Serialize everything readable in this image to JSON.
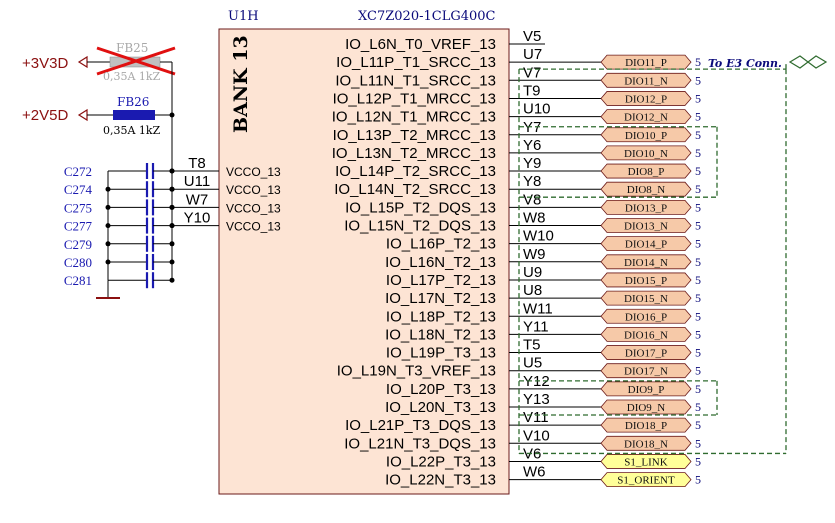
{
  "component": {
    "ref": "U1H",
    "part": "XC7Z020-1CLG400C",
    "bank": "BANK 13",
    "color_fill": "#fde4d4",
    "color_border": "#6b1a1a"
  },
  "power": {
    "p3v3": "+3V3D",
    "p2v5": "+2V5D",
    "fb25": {
      "ref": "FB25",
      "value": "0,35A 1kZ"
    },
    "fb26": {
      "ref": "FB26",
      "value": "0,35A 1kZ"
    },
    "color_power": "#8b1010",
    "color_cross": "#e01010"
  },
  "caps": [
    "C272",
    "C274",
    "C275",
    "C277",
    "C279",
    "C280",
    "C281"
  ],
  "vcco": [
    {
      "pin": "T8",
      "label": "VCCO_13"
    },
    {
      "pin": "U11",
      "label": "VCCO_13"
    },
    {
      "pin": "W7",
      "label": "VCCO_13"
    },
    {
      "pin": "Y10",
      "label": "VCCO_13"
    }
  ],
  "pins": [
    {
      "label": "IO_L6N_T0_VREF_13",
      "num": "V5",
      "net": "",
      "sheet": ""
    },
    {
      "label": "IO_L11P_T1_SRCC_13",
      "num": "U7",
      "net": "DIO11_P",
      "sheet": "5"
    },
    {
      "label": "IO_L11N_T1_SRCC_13",
      "num": "V7",
      "net": "DIO11_N",
      "sheet": "5"
    },
    {
      "label": "IO_L12P_T1_MRCC_13",
      "num": "T9",
      "net": "DIO12_P",
      "sheet": "5"
    },
    {
      "label": "IO_L12N_T1_MRCC_13",
      "num": "U10",
      "net": "DIO12_N",
      "sheet": "5"
    },
    {
      "label": "IO_L13P_T2_MRCC_13",
      "num": "Y7",
      "net": "DIO10_P",
      "sheet": "5"
    },
    {
      "label": "IO_L13N_T2_MRCC_13",
      "num": "Y6",
      "net": "DIO10_N",
      "sheet": "5"
    },
    {
      "label": "IO_L14P_T2_SRCC_13",
      "num": "Y9",
      "net": "DIO8_P",
      "sheet": "5"
    },
    {
      "label": "IO_L14N_T2_SRCC_13",
      "num": "Y8",
      "net": "DIO8_N",
      "sheet": "5"
    },
    {
      "label": "IO_L15P_T2_DQS_13",
      "num": "V8",
      "net": "DIO13_P",
      "sheet": "5"
    },
    {
      "label": "IO_L15N_T2_DQS_13",
      "num": "W8",
      "net": "DIO13_N",
      "sheet": "5"
    },
    {
      "label": "IO_L16P_T2_13",
      "num": "W10",
      "net": "DIO14_P",
      "sheet": "5"
    },
    {
      "label": "IO_L16N_T2_13",
      "num": "W9",
      "net": "DIO14_N",
      "sheet": "5"
    },
    {
      "label": "IO_L17P_T2_13",
      "num": "U9",
      "net": "DIO15_P",
      "sheet": "5"
    },
    {
      "label": "IO_L17N_T2_13",
      "num": "U8",
      "net": "DIO15_N",
      "sheet": "5"
    },
    {
      "label": "IO_L18P_T2_13",
      "num": "W11",
      "net": "DIO16_P",
      "sheet": "5"
    },
    {
      "label": "IO_L18N_T2_13",
      "num": "Y11",
      "net": "DIO16_N",
      "sheet": "5"
    },
    {
      "label": "IO_L19P_T3_13",
      "num": "T5",
      "net": "DIO17_P",
      "sheet": "5"
    },
    {
      "label": "IO_L19N_T3_VREF_13",
      "num": "U5",
      "net": "DIO17_N",
      "sheet": "5"
    },
    {
      "label": "IO_L20P_T3_13",
      "num": "Y12",
      "net": "DIO9_P",
      "sheet": "5"
    },
    {
      "label": "IO_L20N_T3_13",
      "num": "Y13",
      "net": "DIO9_N",
      "sheet": "5"
    },
    {
      "label": "IO_L21P_T3_DQS_13",
      "num": "V11",
      "net": "DIO18_P",
      "sheet": "5"
    },
    {
      "label": "IO_L21N_T3_DQS_13",
      "num": "V10",
      "net": "DIO18_N",
      "sheet": "5"
    },
    {
      "label": "IO_L22P_T3_13",
      "num": "V6",
      "net": "S1_LINK",
      "sheet": "5",
      "yellow": true
    },
    {
      "label": "IO_L22N_T3_13",
      "num": "W6",
      "net": "S1_ORIENT",
      "sheet": "5",
      "yellow": true
    }
  ],
  "connector": {
    "label": "To E3 Conn.",
    "color_dashed": "#2f6b2f",
    "color_port_fill": "#f6c9a8",
    "color_port_yellow": "#ffff99"
  }
}
